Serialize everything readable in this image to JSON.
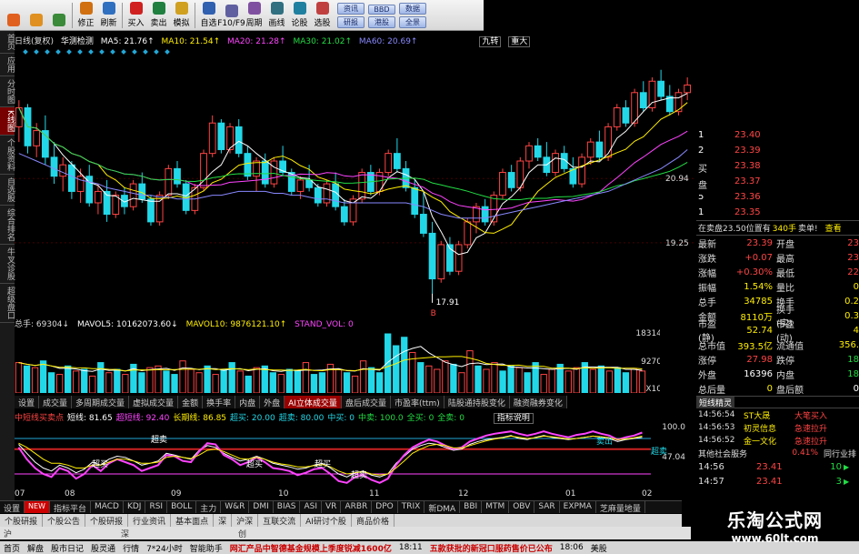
{
  "toolbar": {
    "buttons": [
      {
        "label": "",
        "icon": "home-icon",
        "color": "#e06020"
      },
      {
        "label": "",
        "icon": "back-icon",
        "color": "#e09020"
      },
      {
        "label": "",
        "icon": "forward-icon",
        "color": "#3a8a3a"
      },
      {
        "label": "修正",
        "icon": "fix-icon",
        "color": "#d07010"
      },
      {
        "label": "刷新",
        "icon": "refresh-icon",
        "color": "#3070c0"
      },
      {
        "label": "买入",
        "icon": "buy-icon",
        "color": "#d02020"
      },
      {
        "label": "卖出",
        "icon": "sell-icon",
        "color": "#208040"
      },
      {
        "label": "模拟",
        "icon": "simulate-icon",
        "color": "#d0a020"
      },
      {
        "label": "自选",
        "icon": "watchlist-icon",
        "color": "#3060b0"
      },
      {
        "label": "F10/F9",
        "icon": "f10-icon",
        "color": "#6060a0"
      },
      {
        "label": "周期",
        "icon": "period-icon",
        "color": "#8050a0"
      },
      {
        "label": "画线",
        "icon": "draw-line-icon",
        "color": "#307080"
      },
      {
        "label": "论股",
        "icon": "discuss-icon",
        "color": "#2080a0"
      },
      {
        "label": "选股",
        "icon": "pick-stock-icon",
        "color": "#c04040"
      }
    ],
    "small_buttons": [
      "资讯",
      "研报",
      "BBD",
      "港股",
      "数据",
      "全景"
    ]
  },
  "left_tabs": [
    "首页",
    "应用",
    "分时图",
    "K线图",
    "个股资料",
    "自选股",
    "综合排名",
    "牛叉诊股",
    "超级盘口"
  ],
  "main_header": {
    "period": "日线(复权)",
    "name": "华测检测",
    "ma5": "MA5: 21.76↑",
    "ma10": "MA10: 21.54↑",
    "ma20": "MA20: 21.28↑",
    "ma30": "MA30: 21.02↑",
    "ma60": "MA60: 20.69↑",
    "tag1": "九转",
    "tag2": "重大"
  },
  "main_axis": {
    "labels": [
      "20.94",
      "19.25"
    ]
  },
  "low_marker": "17.91",
  "low_flag": "B",
  "vol_header": {
    "label": "总手: 69304↓",
    "mavol5": "MAVOL5: 10162073.60↓",
    "mavol10": "MAVOL10: 9876121.10↑",
    "stand": "STAND_VOL: 0"
  },
  "vol_axis": [
    "18314",
    "9270",
    "X10"
  ],
  "indicator_tabs": [
    "设置",
    "成交量",
    "多周期成交量",
    "虚拟成交量",
    "金额",
    "换手率",
    "内盘",
    "外盘",
    "AI立体成交量",
    "盘后成交量",
    "市盈率(ttm)",
    "陆股通持股变化",
    "融资融券变化"
  ],
  "indicator_selected": 8,
  "kdj_header": {
    "title": "中短线买卖点",
    "items": [
      {
        "text": "短线: 81.65",
        "color": "#ffffff"
      },
      {
        "text": "超短线: 92.40",
        "color": "#ff44ff"
      },
      {
        "text": "长期线: 86.85",
        "color": "#ffee00"
      },
      {
        "text": "超买: 20.00",
        "color": "#22d8e8"
      },
      {
        "text": "超卖: 80.00",
        "color": "#22d8e8"
      },
      {
        "text": "中买: 0",
        "color": "#22d8e8"
      },
      {
        "text": "中卖: 100.0",
        "color": "#22dd44"
      },
      {
        "text": "全买: 0",
        "color": "#22dd44"
      },
      {
        "text": "全卖: 0",
        "color": "#22dd44"
      }
    ],
    "help": "指标说明"
  },
  "kdj_axis": [
    "100.0",
    "47.04"
  ],
  "kdj_labels": [
    "超买",
    "超卖",
    "超买",
    "超买",
    "超卖",
    "卖出",
    "超卖"
  ],
  "dates": [
    "07",
    "08",
    "09",
    "10",
    "11",
    "12",
    "01",
    "02"
  ],
  "bottom_tabs": [
    "设置",
    "NEW",
    "指标平台",
    "MACD",
    "KDJ",
    "RSI",
    "BOLL",
    "主力",
    "W&R",
    "DMI",
    "BIAS",
    "ASI",
    "VR",
    "ARBR",
    "DPO",
    "TRIX",
    "新DMA",
    "BBI",
    "MTM",
    "OBV",
    "SAR",
    "EXPMA",
    "芝麻量地量"
  ],
  "sub_tabs": [
    "个股研报",
    "个股公告",
    "个股研报",
    "行业资讯",
    "基本面点",
    "深",
    "沪深",
    "互联交流",
    "AI研讨个股",
    "商品价格"
  ],
  "scroll_row": [
    "沪",
    "深",
    "创"
  ],
  "statusbar": [
    "首页",
    "解盘",
    "股市日记",
    "股灵通",
    "行情",
    "7*24小时",
    "智能助手",
    "网汇产品中智德基金规模上季度锐减1600亿",
    "18:11",
    "五款获批的新冠口服药售价已公布",
    "18:06",
    "美股"
  ],
  "bid": {
    "rows": [
      {
        "idx": "1",
        "price": "23.40"
      },
      {
        "idx": "2",
        "price": "23.39"
      },
      {
        "idx": "3",
        "price": "23.38"
      },
      {
        "idx": "4",
        "price": "23.37"
      },
      {
        "idx": "5",
        "price": "23.36"
      },
      {
        "idx": "1",
        "price": "23.35"
      }
    ],
    "side_label": "买盘"
  },
  "inqueue": {
    "text": "在卖盘23.50位置有",
    "count": "340手",
    "sell": "卖单!",
    "more": "查看"
  },
  "quote": [
    {
      "k": "最新",
      "v": "23.39",
      "k2": "开盘",
      "v2": "23"
    },
    {
      "k": "涨跌",
      "v": "+0.07",
      "k2": "最高",
      "v2": "23"
    },
    {
      "k": "涨幅",
      "v": "+0.30%",
      "k2": "最低",
      "v2": "22"
    },
    {
      "k": "振幅",
      "v": "1.54%",
      "k2": "量比",
      "v2": "0"
    },
    {
      "k": "总手",
      "v": "34785",
      "k2": "换手",
      "v2": "0.2"
    },
    {
      "k": "金额",
      "v": "8110万",
      "k2": "换手(实)",
      "v2": "0.3"
    },
    {
      "k": "市盈(静)",
      "v": "52.74",
      "k2": "市盈(动)",
      "v2": "4"
    },
    {
      "k": "总市值",
      "v": "393.5亿",
      "k2": "流通值",
      "v2": "356."
    },
    {
      "k": "涨停",
      "v": "27.98",
      "k2": "跌停",
      "v2": "18"
    },
    {
      "k": "外盘",
      "v": "16396",
      "k2": "内盘",
      "v2": "18"
    },
    {
      "k": "总后量",
      "v": "0",
      "k2": "盘后额",
      "v2": "0"
    }
  ],
  "elf": {
    "title": "短线精灵",
    "rows": [
      {
        "time": "14:56:54",
        "name": "ST大晟",
        "event": "大笔买入"
      },
      {
        "time": "14:56:53",
        "name": "初灵信息",
        "event": "急速拉升"
      },
      {
        "time": "14:56:52",
        "name": "金一文化",
        "event": "急速拉升"
      }
    ],
    "industry_label": "其他社会服务",
    "industry_pct": "0.41%",
    "industry_rank": "同行业排"
  },
  "ticks": [
    {
      "time": "14:56",
      "price": "23.41",
      "vol": "10"
    },
    {
      "time": "14:57",
      "price": "23.41",
      "vol": "3"
    }
  ],
  "watermark": {
    "line1": "乐淘公式网",
    "line2": "www.60lt.com"
  },
  "colors": {
    "up": "#ff4444",
    "down": "#22d8e8",
    "ma5": "#ffffff",
    "ma10": "#ffee00",
    "ma20": "#ff44ff",
    "ma30": "#22dd44",
    "ma60": "#8888ff"
  },
  "chart_data": [
    {
      "type": "candlestick",
      "title": "华测检测 日线(复权)",
      "ylim": [
        17.5,
        24.2
      ],
      "ohlc": [
        [
          22.3,
          23.0,
          21.9,
          22.8
        ],
        [
          22.8,
          22.9,
          21.6,
          21.8
        ],
        [
          21.8,
          22.4,
          21.5,
          22.2
        ],
        [
          22.2,
          22.6,
          21.3,
          21.5
        ],
        [
          21.5,
          21.9,
          20.8,
          21.0
        ],
        [
          21.0,
          21.5,
          20.6,
          21.3
        ],
        [
          21.3,
          21.4,
          20.4,
          20.6
        ],
        [
          20.6,
          21.2,
          20.3,
          21.0
        ],
        [
          21.0,
          21.3,
          20.2,
          20.3
        ],
        [
          20.3,
          20.8,
          20.0,
          20.6
        ],
        [
          20.6,
          20.9,
          19.8,
          20.0
        ],
        [
          20.0,
          20.6,
          19.9,
          20.5
        ],
        [
          20.5,
          20.7,
          20.0,
          20.2
        ],
        [
          20.2,
          20.9,
          20.1,
          20.8
        ],
        [
          20.8,
          21.1,
          20.3,
          20.4
        ],
        [
          20.4,
          20.5,
          19.7,
          19.8
        ],
        [
          19.8,
          20.6,
          19.7,
          20.5
        ],
        [
          20.5,
          21.3,
          20.4,
          21.2
        ],
        [
          21.2,
          21.4,
          20.7,
          20.8
        ],
        [
          20.8,
          20.9,
          20.0,
          20.1
        ],
        [
          20.1,
          20.8,
          20.0,
          20.7
        ],
        [
          20.7,
          21.7,
          20.6,
          21.6
        ],
        [
          21.6,
          22.6,
          21.5,
          22.4
        ],
        [
          22.4,
          22.5,
          21.6,
          21.7
        ],
        [
          21.7,
          22.4,
          21.6,
          22.3
        ],
        [
          22.3,
          22.5,
          21.5,
          21.6
        ],
        [
          21.6,
          21.8,
          20.9,
          21.0
        ],
        [
          21.0,
          21.5,
          20.6,
          21.4
        ],
        [
          21.4,
          21.6,
          20.7,
          20.8
        ],
        [
          20.8,
          21.5,
          20.7,
          21.4
        ],
        [
          21.4,
          21.8,
          21.0,
          21.1
        ],
        [
          21.1,
          21.2,
          20.5,
          20.6
        ],
        [
          20.6,
          21.0,
          20.4,
          20.9
        ],
        [
          20.9,
          21.3,
          20.6,
          20.7
        ],
        [
          20.7,
          20.8,
          20.2,
          20.3
        ],
        [
          20.3,
          20.9,
          20.2,
          20.8
        ],
        [
          20.8,
          21.1,
          20.1,
          20.2
        ],
        [
          20.2,
          20.4,
          19.7,
          19.8
        ],
        [
          19.8,
          20.5,
          19.7,
          20.4
        ],
        [
          20.4,
          21.2,
          20.3,
          21.1
        ],
        [
          21.1,
          21.3,
          20.5,
          20.6
        ],
        [
          20.6,
          21.2,
          20.5,
          21.1
        ],
        [
          21.1,
          21.7,
          21.0,
          21.6
        ],
        [
          21.6,
          22.0,
          21.1,
          21.2
        ],
        [
          21.2,
          21.4,
          20.6,
          20.7
        ],
        [
          20.7,
          20.9,
          19.9,
          20.0
        ],
        [
          20.0,
          20.6,
          19.4,
          19.5
        ],
        [
          19.5,
          19.8,
          17.9,
          18.3
        ],
        [
          18.3,
          19.3,
          18.2,
          19.2
        ],
        [
          19.2,
          19.4,
          18.4,
          18.5
        ],
        [
          18.5,
          19.3,
          18.4,
          19.2
        ],
        [
          19.2,
          19.9,
          19.1,
          19.8
        ],
        [
          19.8,
          20.3,
          19.5,
          20.2
        ],
        [
          20.2,
          20.4,
          19.7,
          19.8
        ],
        [
          19.8,
          20.6,
          19.7,
          20.5
        ],
        [
          20.5,
          21.2,
          20.4,
          21.1
        ],
        [
          21.1,
          21.3,
          20.6,
          20.7
        ],
        [
          20.7,
          21.5,
          20.6,
          21.4
        ],
        [
          21.4,
          21.9,
          21.2,
          21.8
        ],
        [
          21.8,
          22.0,
          21.4,
          21.5
        ],
        [
          21.5,
          21.9,
          21.0,
          21.1
        ],
        [
          21.1,
          21.7,
          21.0,
          21.6
        ],
        [
          21.6,
          21.8,
          21.1,
          21.2
        ],
        [
          21.2,
          21.5,
          20.7,
          20.8
        ],
        [
          20.8,
          21.6,
          20.7,
          21.5
        ],
        [
          21.5,
          22.0,
          21.3,
          21.9
        ],
        [
          21.9,
          22.2,
          21.4,
          21.5
        ],
        [
          21.5,
          22.4,
          21.4,
          22.3
        ],
        [
          22.3,
          22.9,
          22.2,
          22.8
        ],
        [
          22.8,
          23.0,
          22.3,
          22.4
        ],
        [
          22.4,
          23.3,
          22.3,
          23.2
        ],
        [
          23.2,
          23.5,
          22.7,
          22.8
        ],
        [
          22.8,
          23.6,
          22.7,
          23.5
        ],
        [
          23.5,
          23.8,
          23.0,
          23.1
        ],
        [
          23.1,
          23.4,
          22.6,
          22.7
        ],
        [
          22.7,
          23.3,
          22.6,
          23.2
        ],
        [
          23.2,
          23.6,
          23.0,
          23.4
        ]
      ],
      "ma60": [
        21.6,
        21.5,
        21.4,
        21.3,
        21.2,
        21.1,
        21.0,
        20.9,
        20.85,
        20.8,
        20.7,
        20.65,
        20.6,
        20.55,
        20.5,
        20.5,
        20.45,
        20.45,
        20.4,
        20.4,
        20.4,
        20.45,
        20.5,
        20.5,
        20.55,
        20.6,
        20.6,
        20.6,
        20.6,
        20.55,
        20.55,
        20.5,
        20.5,
        20.45,
        20.4,
        20.4,
        20.35,
        20.3,
        20.3,
        20.3,
        20.3,
        20.3,
        20.3,
        20.3,
        20.3,
        20.25,
        20.2,
        20.1,
        20.0,
        19.95,
        19.9,
        19.9,
        19.9,
        19.9,
        19.95,
        20.0,
        20.05,
        20.1,
        20.15,
        20.2,
        20.25,
        20.3,
        20.35,
        20.4,
        20.45,
        20.5,
        20.55,
        20.6,
        20.7,
        20.8,
        20.9,
        21.0,
        21.1,
        21.2,
        21.35,
        21.5,
        21.7
      ]
    },
    {
      "type": "bar",
      "title": "总手",
      "ylim": [
        0,
        18314
      ],
      "values": [
        9000,
        8000,
        7500,
        9500,
        6000,
        5500,
        8000,
        6500,
        7000,
        5000,
        9000,
        6000,
        7000,
        5500,
        8500,
        6000,
        7500,
        8000,
        6500,
        5500,
        9500,
        7000,
        6000,
        8000,
        5500,
        7000,
        9000,
        6500,
        5000,
        7500,
        8000,
        6000,
        5500,
        7000,
        6500,
        9000,
        5500,
        6000,
        8500,
        7000,
        6000,
        5000,
        9500,
        7500,
        6000,
        17500,
        14000,
        16500,
        12000,
        9000,
        8000,
        7000,
        9500,
        8500,
        6000,
        12500,
        8000,
        7000,
        9000,
        6500,
        8000,
        7500,
        6000,
        9000,
        5500,
        7000,
        8500,
        6500,
        7500,
        9000,
        7000,
        8000,
        6500,
        7500,
        6000,
        7000,
        6500
      ]
    },
    {
      "type": "line",
      "title": "中短线买卖点",
      "ylim": [
        0,
        100
      ],
      "series": [
        {
          "name": "短线",
          "values": [
            70,
            55,
            40,
            30,
            25,
            35,
            30,
            22,
            28,
            40,
            35,
            45,
            50,
            48,
            42,
            35,
            38,
            42,
            55,
            52,
            48,
            45,
            60,
            68,
            65,
            55,
            48,
            42,
            45,
            50,
            45,
            38,
            35,
            32,
            28,
            30,
            35,
            38,
            30,
            20,
            15,
            22,
            25,
            18,
            15,
            20,
            38,
            50,
            62,
            68,
            72,
            70,
            65,
            60,
            62,
            70,
            75,
            78,
            80,
            82,
            85,
            80,
            78,
            82,
            85,
            82,
            80,
            78,
            80,
            82,
            84,
            82,
            80,
            75,
            78,
            80,
            82
          ]
        },
        {
          "name": "超短线",
          "values": [
            65,
            45,
            30,
            20,
            15,
            30,
            25,
            12,
            20,
            35,
            25,
            38,
            45,
            40,
            35,
            25,
            30,
            35,
            52,
            50,
            42,
            40,
            58,
            72,
            70,
            52,
            45,
            35,
            40,
            48,
            40,
            30,
            28,
            25,
            18,
            22,
            28,
            30,
            20,
            8,
            5,
            15,
            18,
            10,
            5,
            12,
            35,
            52,
            65,
            72,
            78,
            75,
            68,
            62,
            65,
            75,
            80,
            85,
            88,
            90,
            92,
            88,
            85,
            88,
            92,
            88,
            85,
            82,
            86,
            88,
            92,
            88,
            85,
            78,
            82,
            85,
            90
          ]
        },
        {
          "name": "长期线",
          "values": [
            72,
            65,
            55,
            45,
            38,
            38,
            35,
            30,
            30,
            35,
            35,
            40,
            45,
            45,
            42,
            38,
            38,
            40,
            48,
            50,
            48,
            46,
            52,
            60,
            62,
            58,
            52,
            46,
            45,
            48,
            45,
            40,
            37,
            35,
            32,
            32,
            34,
            36,
            32,
            25,
            20,
            22,
            24,
            20,
            18,
            20,
            30,
            42,
            55,
            62,
            68,
            70,
            68,
            64,
            64,
            68,
            72,
            76,
            79,
            81,
            84,
            82,
            80,
            81,
            84,
            83,
            81,
            79,
            80,
            82,
            84,
            83,
            81,
            78,
            79,
            81,
            84
          ]
        }
      ]
    }
  ]
}
